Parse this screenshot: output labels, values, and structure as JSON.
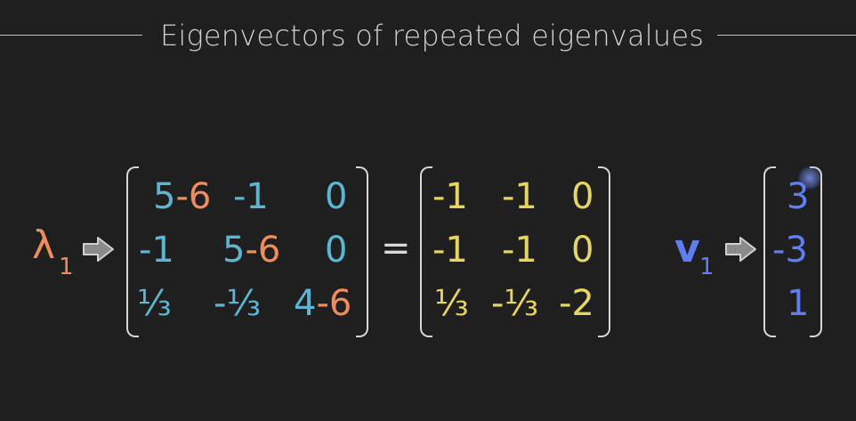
{
  "title": "Eigenvectors of repeated eigenvalues",
  "lambda": {
    "symbol": "λ",
    "subscript": "1"
  },
  "vector": {
    "symbol": "v",
    "subscript": "1"
  },
  "equals": "=",
  "matrix_a": {
    "rows": [
      [
        {
          "base": "5",
          "minus": "-6"
        },
        {
          "base": "-1"
        },
        {
          "base": "0"
        }
      ],
      [
        {
          "base": "-1"
        },
        {
          "base": "5",
          "minus": "-6"
        },
        {
          "base": "0"
        }
      ],
      [
        {
          "base": "⅓"
        },
        {
          "base": "-⅓"
        },
        {
          "base": "4",
          "minus": "-6"
        }
      ]
    ]
  },
  "matrix_b": {
    "rows": [
      [
        "-1",
        "-1",
        "0"
      ],
      [
        "-1",
        "-1",
        "0"
      ],
      [
        "⅓",
        "-⅓",
        "-2"
      ]
    ]
  },
  "vector_v": [
    "3",
    "-3",
    "1"
  ],
  "colors": {
    "teal": "#5bb6d1",
    "orange": "#ef8c5a",
    "yellow": "#e7d65a",
    "blue": "#5f7ef2",
    "background": "#1f1f20"
  },
  "icons": [
    "right-arrow-icon"
  ]
}
